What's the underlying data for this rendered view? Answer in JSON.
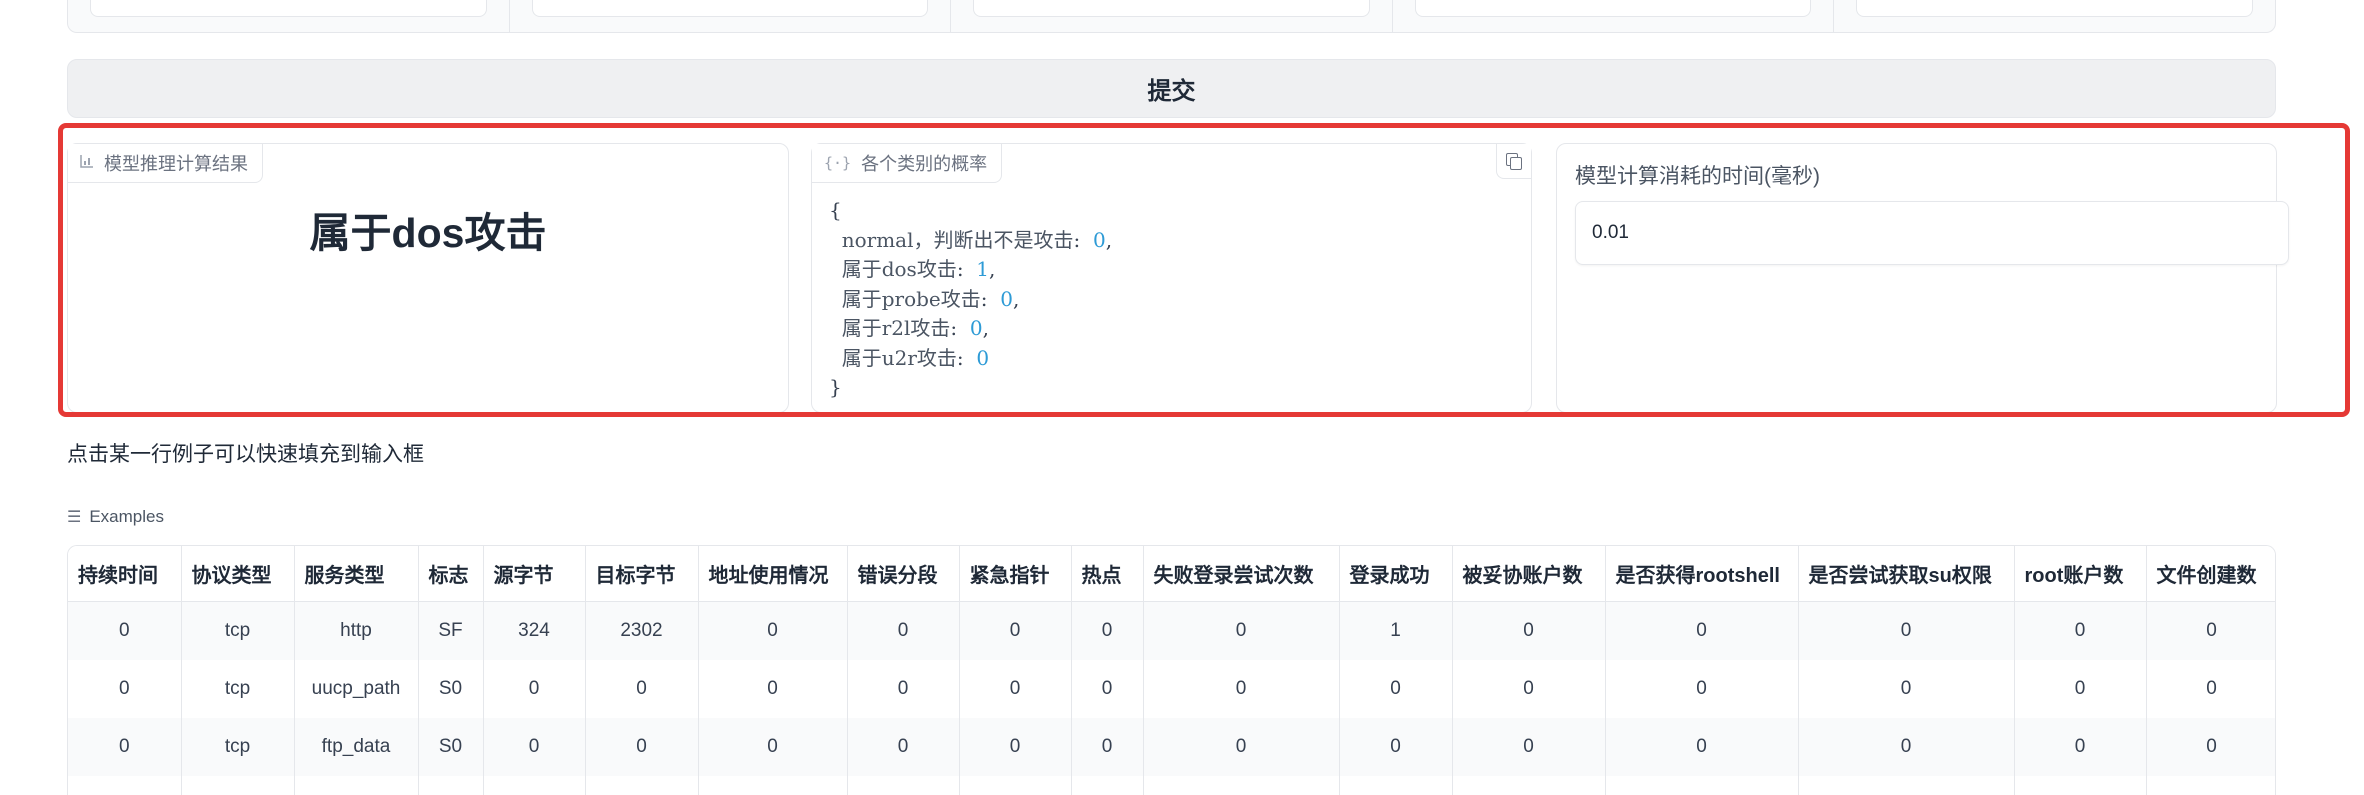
{
  "submit": {
    "label": "提交"
  },
  "result_panel": {
    "tag_label": "模型推理计算结果",
    "tag_icon": "bar-chart-icon",
    "value": "属于dos攻击"
  },
  "prob_panel": {
    "tag_label": "各个类别的概率",
    "tag_icon": "json-braces-icon",
    "copy_icon": "copy-icon",
    "open_brace": "{",
    "close_brace": "}",
    "entries": [
      {
        "key": "normal，判断出不是攻击",
        "value": "0",
        "sep": ","
      },
      {
        "key": "属于dos攻击",
        "value": "1",
        "sep": ","
      },
      {
        "key": "属于probe攻击",
        "value": "0",
        "sep": ","
      },
      {
        "key": "属于r2l攻击",
        "value": "0",
        "sep": ","
      },
      {
        "key": "属于u2r攻击",
        "value": "0",
        "sep": ""
      }
    ]
  },
  "time_panel": {
    "label": "模型计算消耗的时间(毫秒)",
    "value": "0.01"
  },
  "hint": "点击某一行例子可以快速填充到输入框",
  "examples": {
    "title": "Examples",
    "title_icon": "list-icon",
    "headers": [
      "持续时间",
      "协议类型",
      "服务类型",
      "标志",
      "源字节",
      "目标字节",
      "地址使用情况",
      "错误分段",
      "紧急指针",
      "热点",
      "失败登录尝试次数",
      "登录成功",
      "被妥协账户数",
      "是否获得rootshell",
      "是否尝试获取su权限",
      "root账户数",
      "文件创建数"
    ],
    "rows": [
      [
        "0",
        "tcp",
        "http",
        "SF",
        "324",
        "2302",
        "0",
        "0",
        "0",
        "0",
        "0",
        "1",
        "0",
        "0",
        "0",
        "0",
        "0"
      ],
      [
        "0",
        "tcp",
        "uucp_path",
        "S0",
        "0",
        "0",
        "0",
        "0",
        "0",
        "0",
        "0",
        "0",
        "0",
        "0",
        "0",
        "0",
        "0"
      ],
      [
        "0",
        "tcp",
        "ftp_data",
        "S0",
        "0",
        "0",
        "0",
        "0",
        "0",
        "0",
        "0",
        "0",
        "0",
        "0",
        "0",
        "0",
        "0"
      ],
      [
        "",
        "",
        "",
        "",
        "",
        "",
        "",
        "",
        "",
        "",
        "",
        "",
        "",
        "",
        "",
        "",
        ""
      ]
    ]
  },
  "colors": {
    "highlight": "#e53935",
    "number": "#2e9bd6",
    "submit_bg": "#eff0f2"
  }
}
